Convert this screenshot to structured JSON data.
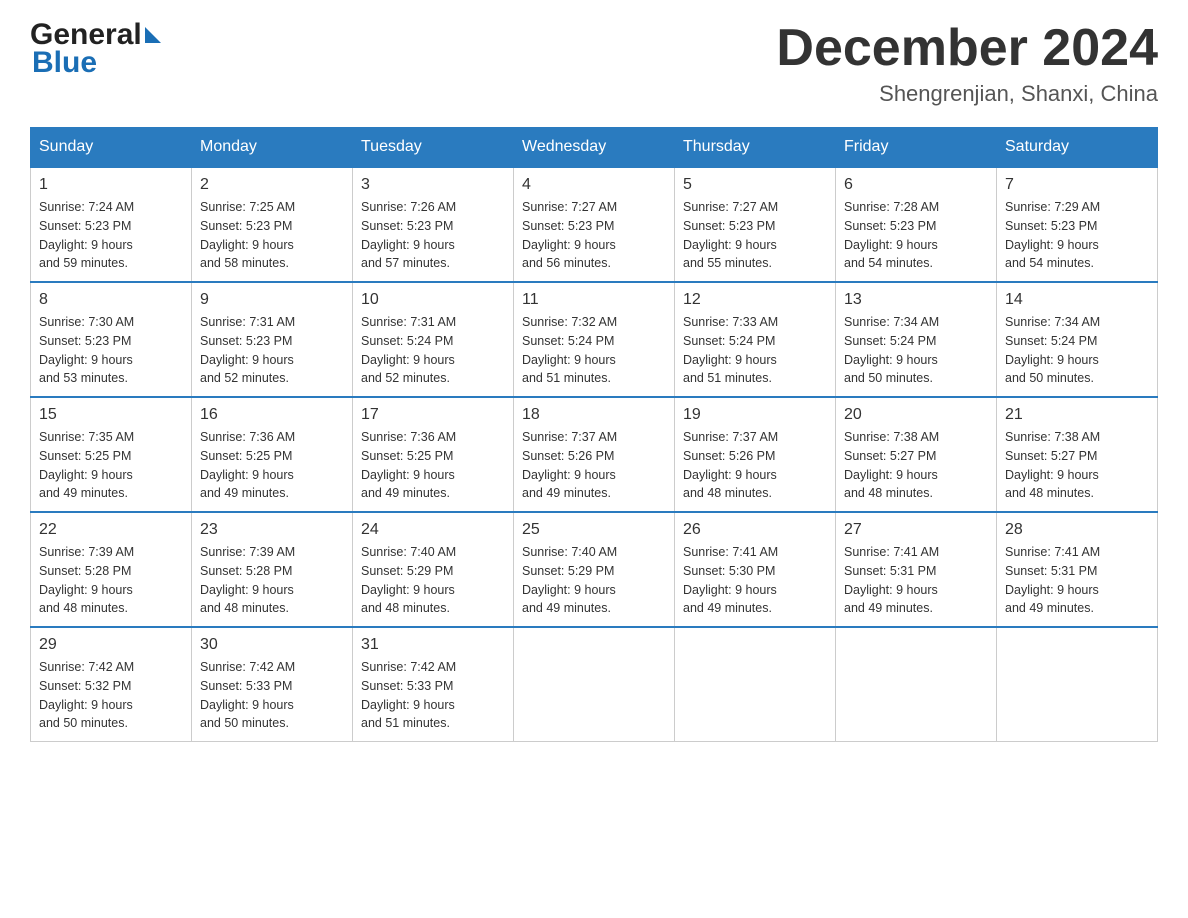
{
  "header": {
    "logo_general": "General",
    "logo_blue": "Blue",
    "month_title": "December 2024",
    "location": "Shengrenjian, Shanxi, China"
  },
  "days_of_week": [
    "Sunday",
    "Monday",
    "Tuesday",
    "Wednesday",
    "Thursday",
    "Friday",
    "Saturday"
  ],
  "weeks": [
    [
      {
        "num": "1",
        "sunrise": "7:24 AM",
        "sunset": "5:23 PM",
        "daylight": "9 hours and 59 minutes."
      },
      {
        "num": "2",
        "sunrise": "7:25 AM",
        "sunset": "5:23 PM",
        "daylight": "9 hours and 58 minutes."
      },
      {
        "num": "3",
        "sunrise": "7:26 AM",
        "sunset": "5:23 PM",
        "daylight": "9 hours and 57 minutes."
      },
      {
        "num": "4",
        "sunrise": "7:27 AM",
        "sunset": "5:23 PM",
        "daylight": "9 hours and 56 minutes."
      },
      {
        "num": "5",
        "sunrise": "7:27 AM",
        "sunset": "5:23 PM",
        "daylight": "9 hours and 55 minutes."
      },
      {
        "num": "6",
        "sunrise": "7:28 AM",
        "sunset": "5:23 PM",
        "daylight": "9 hours and 54 minutes."
      },
      {
        "num": "7",
        "sunrise": "7:29 AM",
        "sunset": "5:23 PM",
        "daylight": "9 hours and 54 minutes."
      }
    ],
    [
      {
        "num": "8",
        "sunrise": "7:30 AM",
        "sunset": "5:23 PM",
        "daylight": "9 hours and 53 minutes."
      },
      {
        "num": "9",
        "sunrise": "7:31 AM",
        "sunset": "5:23 PM",
        "daylight": "9 hours and 52 minutes."
      },
      {
        "num": "10",
        "sunrise": "7:31 AM",
        "sunset": "5:24 PM",
        "daylight": "9 hours and 52 minutes."
      },
      {
        "num": "11",
        "sunrise": "7:32 AM",
        "sunset": "5:24 PM",
        "daylight": "9 hours and 51 minutes."
      },
      {
        "num": "12",
        "sunrise": "7:33 AM",
        "sunset": "5:24 PM",
        "daylight": "9 hours and 51 minutes."
      },
      {
        "num": "13",
        "sunrise": "7:34 AM",
        "sunset": "5:24 PM",
        "daylight": "9 hours and 50 minutes."
      },
      {
        "num": "14",
        "sunrise": "7:34 AM",
        "sunset": "5:24 PM",
        "daylight": "9 hours and 50 minutes."
      }
    ],
    [
      {
        "num": "15",
        "sunrise": "7:35 AM",
        "sunset": "5:25 PM",
        "daylight": "9 hours and 49 minutes."
      },
      {
        "num": "16",
        "sunrise": "7:36 AM",
        "sunset": "5:25 PM",
        "daylight": "9 hours and 49 minutes."
      },
      {
        "num": "17",
        "sunrise": "7:36 AM",
        "sunset": "5:25 PM",
        "daylight": "9 hours and 49 minutes."
      },
      {
        "num": "18",
        "sunrise": "7:37 AM",
        "sunset": "5:26 PM",
        "daylight": "9 hours and 49 minutes."
      },
      {
        "num": "19",
        "sunrise": "7:37 AM",
        "sunset": "5:26 PM",
        "daylight": "9 hours and 48 minutes."
      },
      {
        "num": "20",
        "sunrise": "7:38 AM",
        "sunset": "5:27 PM",
        "daylight": "9 hours and 48 minutes."
      },
      {
        "num": "21",
        "sunrise": "7:38 AM",
        "sunset": "5:27 PM",
        "daylight": "9 hours and 48 minutes."
      }
    ],
    [
      {
        "num": "22",
        "sunrise": "7:39 AM",
        "sunset": "5:28 PM",
        "daylight": "9 hours and 48 minutes."
      },
      {
        "num": "23",
        "sunrise": "7:39 AM",
        "sunset": "5:28 PM",
        "daylight": "9 hours and 48 minutes."
      },
      {
        "num": "24",
        "sunrise": "7:40 AM",
        "sunset": "5:29 PM",
        "daylight": "9 hours and 48 minutes."
      },
      {
        "num": "25",
        "sunrise": "7:40 AM",
        "sunset": "5:29 PM",
        "daylight": "9 hours and 49 minutes."
      },
      {
        "num": "26",
        "sunrise": "7:41 AM",
        "sunset": "5:30 PM",
        "daylight": "9 hours and 49 minutes."
      },
      {
        "num": "27",
        "sunrise": "7:41 AM",
        "sunset": "5:31 PM",
        "daylight": "9 hours and 49 minutes."
      },
      {
        "num": "28",
        "sunrise": "7:41 AM",
        "sunset": "5:31 PM",
        "daylight": "9 hours and 49 minutes."
      }
    ],
    [
      {
        "num": "29",
        "sunrise": "7:42 AM",
        "sunset": "5:32 PM",
        "daylight": "9 hours and 50 minutes."
      },
      {
        "num": "30",
        "sunrise": "7:42 AM",
        "sunset": "5:33 PM",
        "daylight": "9 hours and 50 minutes."
      },
      {
        "num": "31",
        "sunrise": "7:42 AM",
        "sunset": "5:33 PM",
        "daylight": "9 hours and 51 minutes."
      },
      null,
      null,
      null,
      null
    ]
  ],
  "labels": {
    "sunrise": "Sunrise:",
    "sunset": "Sunset:",
    "daylight": "Daylight:"
  }
}
